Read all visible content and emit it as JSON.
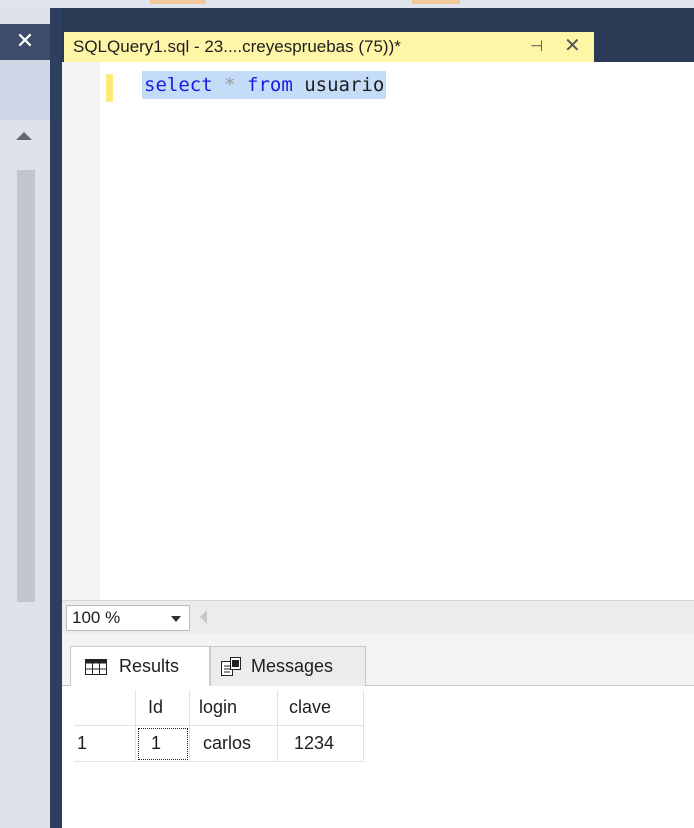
{
  "tab": {
    "title": "SQLQuery1.sql - 23....creyespruebas (75))*",
    "pin_glyph": "⊣",
    "close_glyph": "✕"
  },
  "left_panel": {
    "close_glyph": "✕"
  },
  "editor": {
    "query": {
      "keyword1": "select",
      "operator": "*",
      "keyword2": "from",
      "table": "usuario"
    }
  },
  "zoom": {
    "value": "100 %"
  },
  "results_tabs": {
    "results": "Results",
    "messages": "Messages"
  },
  "grid": {
    "columns": [
      "Id",
      "login",
      "clave"
    ],
    "rows": [
      {
        "row_number": "1",
        "cells": [
          "1",
          "carlos",
          "1234"
        ]
      }
    ]
  },
  "colors": {
    "tab_active": "#fff5a6",
    "selection": "#c5dcf8",
    "keyword": "#1a1ae0",
    "frame": "#2b3a55"
  }
}
